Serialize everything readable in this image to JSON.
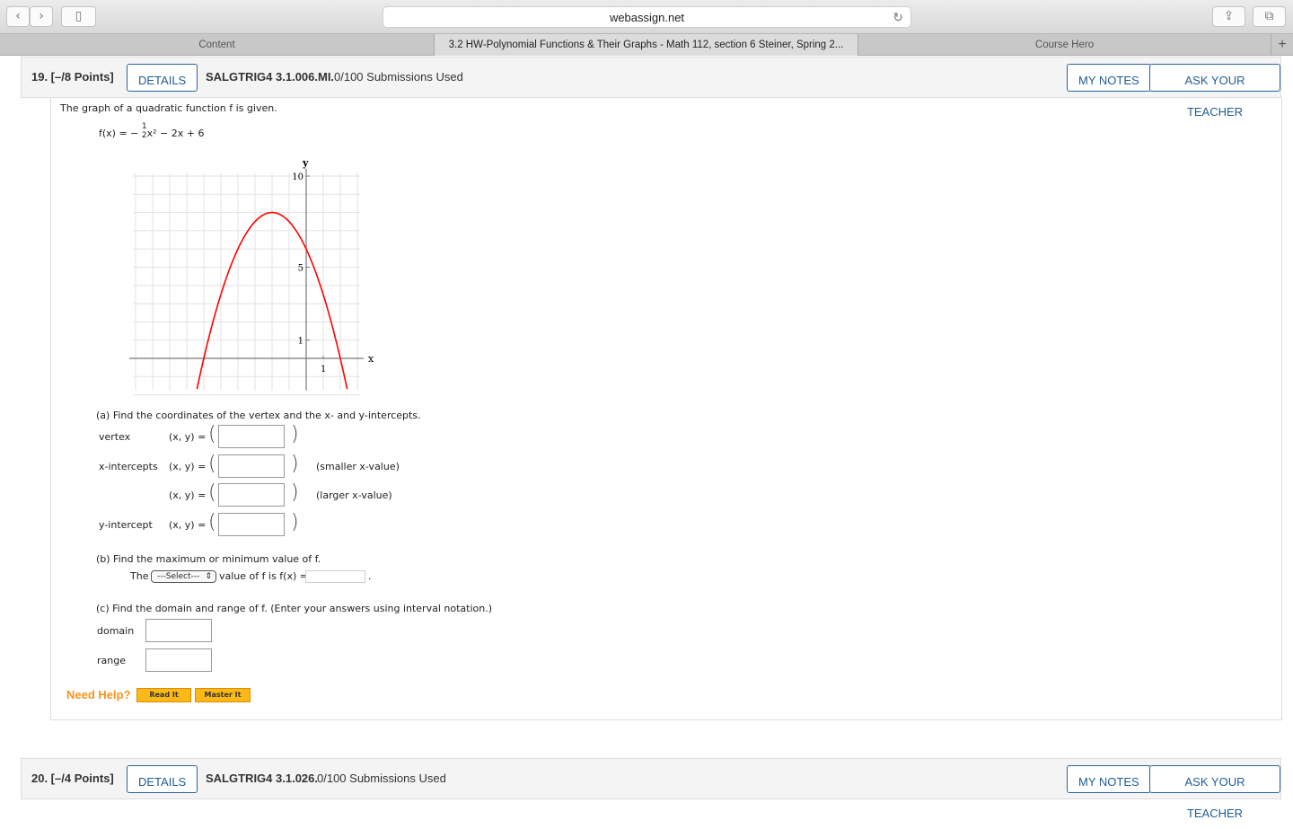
{
  "browser": {
    "url": "webassign.net",
    "tabs": [
      {
        "label": "Content"
      },
      {
        "label": "3.2 HW-Polynomial Functions & Their Graphs - Math 112, section 6 Steiner, Spring 2..."
      },
      {
        "label": "Course Hero"
      }
    ],
    "new_tab": "+"
  },
  "q19": {
    "number": "19.  [–/8 Points]",
    "details": "DETAILS",
    "code": "SALGTRIG4 3.1.006.MI.",
    "submissions": "0/100 Submissions Used",
    "my_notes": "MY NOTES",
    "ask_teacher": "ASK YOUR TEACHER",
    "intro": "The graph of a quadratic function f is given.",
    "formula": {
      "lhs": "f(x) = −",
      "num": "1",
      "den": "2",
      "rest": "x² − 2x + 6"
    },
    "part_a": "(a) Find the coordinates of the vertex and the x- and y-intercepts.",
    "rows": [
      {
        "label": "vertex",
        "xy": "(x, y)  =",
        "note": ""
      },
      {
        "label": "x-intercepts",
        "xy": "(x, y)  =",
        "note": "(smaller x-value)"
      },
      {
        "label": "",
        "xy": "(x, y)  =",
        "note": "(larger x-value)"
      },
      {
        "label": "y-intercept",
        "xy": "(x, y)  =",
        "note": ""
      }
    ],
    "part_b": "(b) Find the maximum or minimum value of f.",
    "b_the": "The",
    "b_select": "---Select---",
    "b_rest": "value of f is f(x) =",
    "b_dot": ".",
    "part_c": "(c) Find the domain and range of f. (Enter your answers using interval notation.)",
    "domain": "domain",
    "range": "range",
    "need_help": "Need Help?",
    "read_it": "Read It",
    "master_it": "Master It"
  },
  "q20": {
    "number": "20.  [–/4 Points]",
    "details": "DETAILS",
    "code": "SALGTRIG4 3.1.026.",
    "submissions": "0/100 Submissions Used",
    "my_notes": "MY NOTES",
    "ask_teacher": "ASK YOUR TEACHER"
  },
  "chart_data": {
    "type": "line",
    "function": "-0.5x^2-2x+6",
    "xlabel": "x",
    "ylabel": "y",
    "xlim": [
      -10,
      3
    ],
    "ylim": [
      -2,
      10
    ],
    "xticks": [
      {
        "v": 1,
        "label": "1"
      }
    ],
    "yticks": [
      {
        "v": 1,
        "label": "1"
      },
      {
        "v": 5,
        "label": "5"
      },
      {
        "v": 10,
        "label": "10"
      }
    ],
    "grid": true,
    "curve_color": "#ff0000"
  }
}
